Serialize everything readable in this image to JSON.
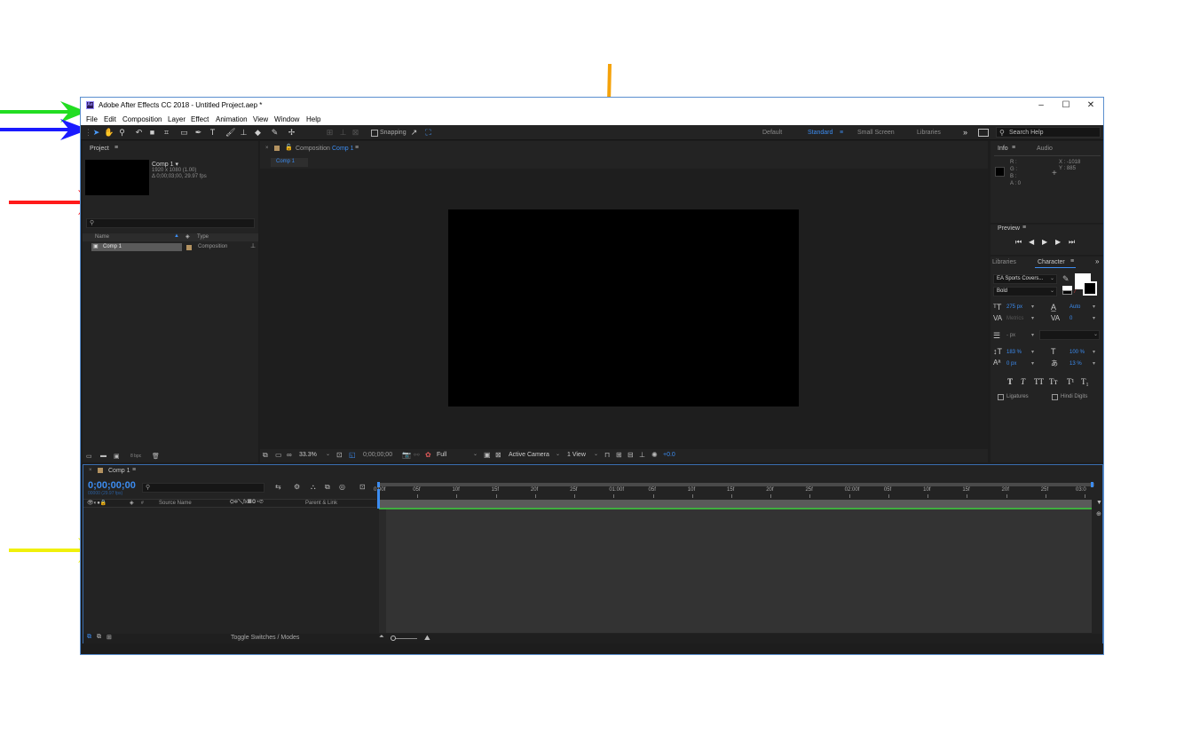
{
  "window": {
    "title": "Adobe After Effects CC 2018 - Untitled Project.aep *",
    "app_icon_text": "Ae"
  },
  "menu": [
    "File",
    "Edit",
    "Composition",
    "Layer",
    "Effect",
    "Animation",
    "View",
    "Window",
    "Help"
  ],
  "toolbar": {
    "snapping_label": "Snapping",
    "workspaces": [
      "Default",
      "Standard",
      "Small Screen",
      "Libraries"
    ],
    "active_workspace": "Standard",
    "search_placeholder": "Search Help"
  },
  "project": {
    "tab_label": "Project",
    "comp_name": "Comp 1 ▾",
    "comp_size": "1920 x 1080 (1.00)",
    "comp_duration": "Δ 0;00;03;00, 29.97 fps",
    "columns": {
      "name": "Name",
      "type": "Type"
    },
    "rows": [
      {
        "name": "Comp 1",
        "type": "Composition"
      }
    ],
    "bpc": "8 bpc"
  },
  "composition": {
    "tab_prefix": "Composition",
    "tab_comp": "Comp 1",
    "subtab": "Comp 1",
    "zoom": "33.3%",
    "timecode": "0;00;00;00",
    "resolution": "Full",
    "camera": "Active Camera",
    "views": "1 View",
    "exposure": "+0.0"
  },
  "info": {
    "tab_info": "Info",
    "tab_audio": "Audio",
    "r": "R :",
    "g": "G :",
    "b": "B :",
    "a": "A : 0",
    "x": "X : -1018",
    "y": "Y : 885"
  },
  "preview": {
    "tab_label": "Preview"
  },
  "character": {
    "tab_libraries": "Libraries",
    "tab_character": "Character",
    "font_family": "EA Sports Covers...",
    "font_style": "Bold",
    "font_size": "275 px",
    "leading": "Auto",
    "kerning": "Metrics",
    "tracking": "0",
    "stroke_width": "- px",
    "vscale": "183 %",
    "hscale": "100 %",
    "baseline": "0 px",
    "tsume": "13 %",
    "style_buttons": [
      "T",
      "T",
      "TT",
      "Tт",
      "T¹",
      "T₁"
    ],
    "ligatures_label": "Ligatures",
    "hindi_label": "Hindi Digits",
    "fill_color": "#ffffff",
    "stroke_color": "#000000"
  },
  "timeline": {
    "tab_label": "Comp 1",
    "timecode": "0;00;00;00",
    "frame_info": "00000 (29.97 fps)",
    "col_source": "Source Name",
    "col_parent": "Parent & Link",
    "toggle_label": "Toggle Switches / Modes",
    "ruler": [
      "0:00f",
      "05f",
      "10f",
      "15f",
      "20f",
      "25f",
      "01:00f",
      "05f",
      "10f",
      "15f",
      "20f",
      "25f",
      "02:00f",
      "05f",
      "10f",
      "15f",
      "20f",
      "25f",
      "03:0"
    ]
  },
  "colors": {
    "accent": "#3c8cf0",
    "arrow_green": "#22dd22",
    "arrow_blue": "#1a1aff",
    "arrow_red": "#ff1a1a",
    "arrow_orange": "#f5a20a",
    "arrow_yellow": "#f0f00a",
    "work_area": "#3fae3f"
  }
}
